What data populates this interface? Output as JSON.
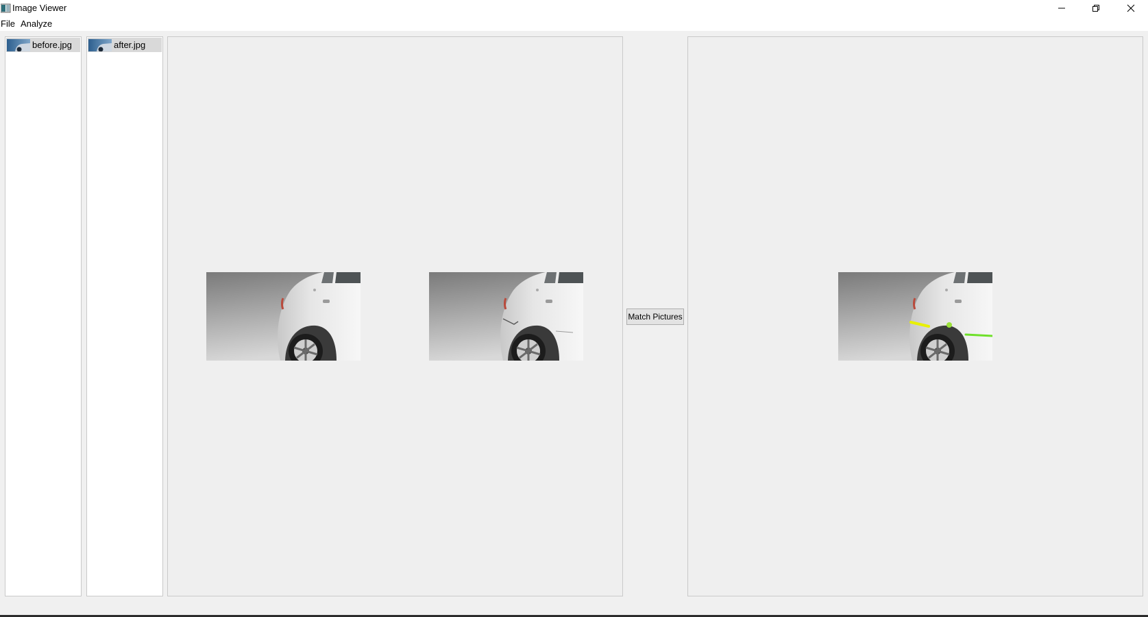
{
  "window": {
    "title": "Image Viewer",
    "icon": "app-icon",
    "controls": [
      "minimize-icon",
      "restore-icon",
      "close-icon"
    ]
  },
  "menu": {
    "items": [
      {
        "label": "File"
      },
      {
        "label": "Analyze"
      }
    ]
  },
  "lists": {
    "before": {
      "items": [
        {
          "label": "before.jpg",
          "icon": "image-thumbnail-icon"
        }
      ]
    },
    "after": {
      "items": [
        {
          "label": "after.jpg",
          "icon": "image-thumbnail-icon"
        }
      ]
    }
  },
  "actions": {
    "match_label": "Match Pictures"
  },
  "colors": {
    "window_bg": "#f0f0f0",
    "panel_bg": "#efefef",
    "selected_item": "#d9d9d9",
    "highlight_yellow": "#e8f000",
    "highlight_green": "#6fe02a"
  }
}
